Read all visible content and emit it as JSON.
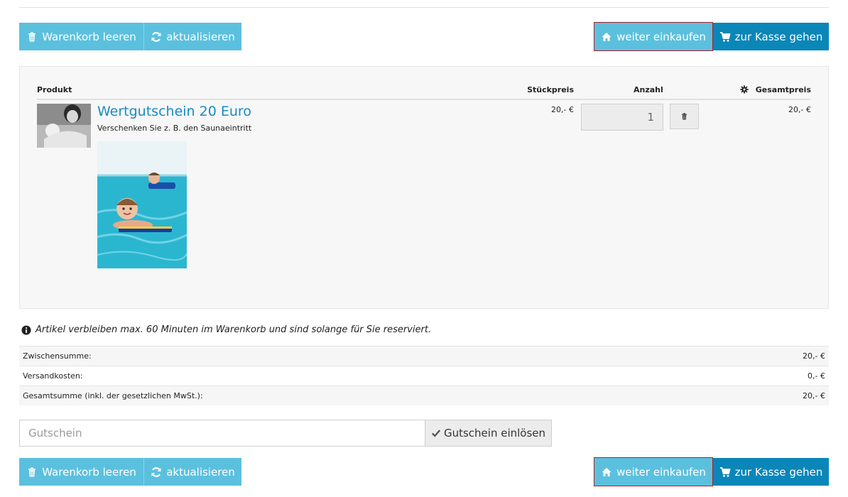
{
  "toolbar": {
    "clear_cart": "Warenkorb leeren",
    "update": "aktualisieren",
    "continue_shopping": "weiter einkaufen",
    "checkout": "zur Kasse gehen"
  },
  "table": {
    "headers": {
      "product": "Produkt",
      "unit_price": "Stückpreis",
      "quantity": "Anzahl",
      "total": "Gesamtpreis"
    },
    "items": [
      {
        "title": "Wertgutschein 20 Euro",
        "description": "Verschenken Sie z. B. den Saunaeintritt",
        "unit_price": "20,- €",
        "quantity": "1",
        "total": "20,- €"
      }
    ]
  },
  "notice": "Artikel verbleiben max. 60 Minuten im Warenkorb und sind solange für Sie reserviert.",
  "summary": [
    {
      "label": "Zwischensumme:",
      "value": "20,- €"
    },
    {
      "label": "Versandkosten:",
      "value": "0,- €"
    },
    {
      "label": "Gesamtsumme (inkl. der gesetzlichen MwSt.):",
      "value": "20,- €"
    }
  ],
  "voucher": {
    "placeholder": "Gutschein",
    "button": "Gutschein einlösen"
  },
  "icons": {
    "clear_cart": "trash-icon",
    "update": "refresh-icon",
    "continue_shopping": "home-icon",
    "checkout": "cart-icon",
    "settings": "gear-icon",
    "remove_item": "trash-icon",
    "notice": "info-icon",
    "voucher_button": "check-icon"
  },
  "colors": {
    "primary_light": "#5bc0de",
    "primary_dark": "#0a86b8",
    "link": "#1a8ac2"
  }
}
